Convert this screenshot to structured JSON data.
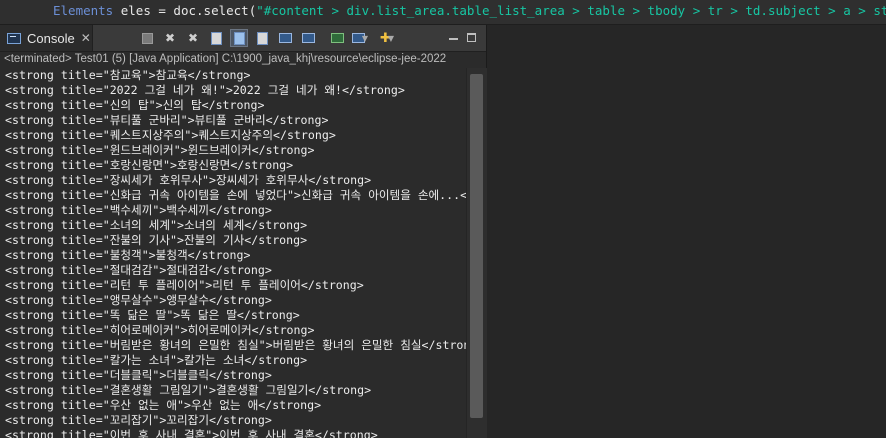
{
  "editor": {
    "code_type": "Elements",
    "code_var": "eles",
    "code_mid": " = doc.select(",
    "code_str": "\"#content > div.list_area.table_list_area > table > tbody > tr > td.subject > a > strong\"",
    "code_end": ");"
  },
  "console": {
    "tab_label": "Console",
    "tab_close": "✕",
    "status": "<terminated> Test01 (5) [Java Application] C:\\1900_java_khj\\resource\\eclipse-jee-2022",
    "scroll_level_percent": 96,
    "lines": [
      "<strong title=\"참교육\">참교육</strong>",
      "<strong title=\"2022 그걸 네가 왜!\">2022 그걸 네가 왜!</strong>",
      "<strong title=\"신의 탑\">신의 탑</strong>",
      "<strong title=\"뷰티풀 군바리\">뷰티풀 군바리</strong>",
      "<strong title=\"퀘스트지상주의\">퀘스트지상주의</strong>",
      "<strong title=\"윈드브레이커\">윈드브레이커</strong>",
      "<strong title=\"호랑신랑면\">호랑신랑면</strong>",
      "<strong title=\"장씨세가 호위무사\">장씨세가 호위무사</strong>",
      "<strong title=\"신화급 귀속 아이템을 손에 넣었다\">신화급 귀속 아이템을 손에...</st",
      "<strong title=\"백수세끼\">백수세끼</strong>",
      "<strong title=\"소녀의 세계\">소녀의 세계</strong>",
      "<strong title=\"잔불의 기사\">잔불의 기사</strong>",
      "<strong title=\"불청객\">불청객</strong>",
      "<strong title=\"절대검감\">절대검감</strong>",
      "<strong title=\"리턴 투 플레이어\">리턴 투 플레이어</strong>",
      "<strong title=\"앵무살수\">앵무살수</strong>",
      "<strong title=\"똑 닮은 딸\">똑 닮은 딸</strong>",
      "<strong title=\"히어로메이커\">히어로메이커</strong>",
      "<strong title=\"버림받은 황녀의 은밀한 침실\">버림받은 황녀의 은밀한 침실</strong>",
      "<strong title=\"칼가는 소녀\">칼가는 소녀</strong>",
      "<strong title=\"더블클릭\">더블클릭</strong>",
      "<strong title=\"결혼생활 그림일기\">결혼생활 그림일기</strong>",
      "<strong title=\"우산 없는 애\">우산 없는 애</strong>",
      "<strong title=\"꼬리잡기\">꼬리잡기</strong>",
      "<strong title=\"이번 후 사내 결혼\">이번 후 사내 결혼</strong>"
    ]
  },
  "toolbar": {
    "icons": [
      "terminate-icon",
      "remove-launch-icon",
      "remove-all-terminated-icon",
      "clear-console-icon",
      "scroll-lock-icon",
      "word-wrap-icon",
      "show-stdout-icon",
      "show-stderr-icon",
      "pin-console-icon",
      "display-console-icon",
      "open-console-icon"
    ]
  },
  "colors": {
    "background": "#2b2b2b",
    "keyword_type": "#6c8fd6",
    "string": "#17c6a3",
    "text": "#ececec"
  }
}
